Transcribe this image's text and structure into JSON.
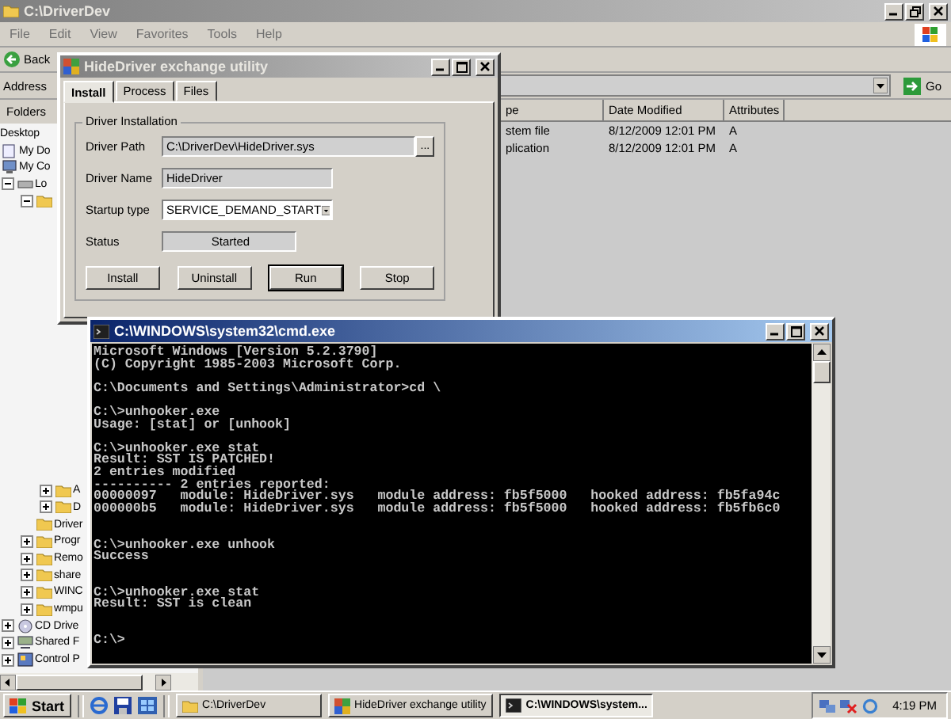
{
  "explorer": {
    "title": "C:\\DriverDev",
    "active": false,
    "menu": [
      "File",
      "Edit",
      "View",
      "Favorites",
      "Tools",
      "Help"
    ],
    "toolbar": {
      "back": "Back"
    },
    "address": {
      "label": "Address",
      "go": "Go"
    },
    "folders_pane": {
      "title": "Folders",
      "tree": [
        {
          "label": "Desktop",
          "children": [
            {
              "label": "My Do",
              "kind": "documents"
            },
            {
              "label": "My Co",
              "kind": "computer",
              "children": [
                {
                  "label": "Lo",
                  "kind": "drive",
                  "expanded": true,
                  "children": [
                    {
                      "kind": "folder",
                      "expanded": true,
                      "children": [
                        {
                          "label": "A",
                          "kind": "folder",
                          "expanded": false
                        },
                        {
                          "label": "D",
                          "kind": "folder",
                          "expanded": false
                        }
                      ]
                    },
                    {
                      "label": "Driver",
                      "kind": "folder"
                    },
                    {
                      "label": "Progr",
                      "kind": "folder",
                      "expanded": false
                    },
                    {
                      "label": "Remo",
                      "kind": "folder",
                      "expanded": false
                    },
                    {
                      "label": "share",
                      "kind": "folder",
                      "expanded": false
                    },
                    {
                      "label": "WINC",
                      "kind": "folder",
                      "expanded": false
                    },
                    {
                      "label": "wmpu",
                      "kind": "folder",
                      "expanded": false
                    }
                  ]
                },
                {
                  "label": "CD Drive",
                  "kind": "cd",
                  "expanded": false
                },
                {
                  "label": "Shared F",
                  "kind": "shared",
                  "expanded": false
                },
                {
                  "label": "Control P",
                  "kind": "control",
                  "expanded": false
                }
              ]
            }
          ]
        }
      ]
    },
    "file_list": {
      "columns": [
        "pe",
        "Date Modified",
        "Attributes"
      ],
      "rows": [
        [
          "stem file",
          "8/12/2009 12:01 PM",
          "A"
        ],
        [
          "plication",
          "8/12/2009 12:01 PM",
          "A"
        ]
      ]
    }
  },
  "dialog": {
    "title": "HideDriver exchange utility",
    "active": false,
    "tabs": [
      {
        "label": "Install",
        "selected": true
      },
      {
        "label": "Process",
        "selected": false
      },
      {
        "label": "Files",
        "selected": false
      }
    ],
    "group": {
      "title": "Driver Installation",
      "fields": [
        {
          "kind": "path",
          "label": "Driver Path",
          "value": "C:\\DriverDev\\HideDriver.sys",
          "button": "..."
        },
        {
          "kind": "text",
          "label": "Driver Name",
          "value": "HideDriver"
        },
        {
          "kind": "dropdown",
          "label": "Startup type",
          "value": "SERVICE_DEMAND_START"
        },
        {
          "kind": "readonly",
          "label": "Status",
          "value": "Started"
        }
      ],
      "buttons": [
        {
          "label": "Install",
          "default": false
        },
        {
          "label": "Uninstall",
          "default": false
        },
        {
          "label": "Run",
          "default": true
        },
        {
          "label": "Stop",
          "default": false
        }
      ]
    }
  },
  "console": {
    "title": "C:\\WINDOWS\\system32\\cmd.exe",
    "active": true,
    "output": "Microsoft Windows [Version 5.2.3790]\n(C) Copyright 1985-2003 Microsoft Corp.\n\nC:\\Documents and Settings\\Administrator>cd \\\n\nC:\\>unhooker.exe\nUsage: [stat] or [unhook]\n\nC:\\>unhooker.exe stat\nResult: SST IS PATCHED!\n2 entries modified\n---------- 2 entries reported:\n00000097   module: HideDriver.sys   module address: fb5f5000   hooked address: fb5fa94c\n000000b5   module: HideDriver.sys   module address: fb5f5000   hooked address: fb5fb6c0\n\n\nC:\\>unhooker.exe unhook\nSuccess\n\n\nC:\\>unhooker.exe stat\nResult: SST is clean\n\n\nC:\\>"
  },
  "taskbar": {
    "start": "Start",
    "tasks": [
      {
        "label": "C:\\DriverDev",
        "kind": "folder",
        "selected": false
      },
      {
        "label": "HideDriver exchange utility",
        "kind": "app",
        "selected": false
      },
      {
        "label": "C:\\WINDOWS\\system...",
        "kind": "console",
        "selected": true
      }
    ],
    "clock": "4:19 PM"
  }
}
